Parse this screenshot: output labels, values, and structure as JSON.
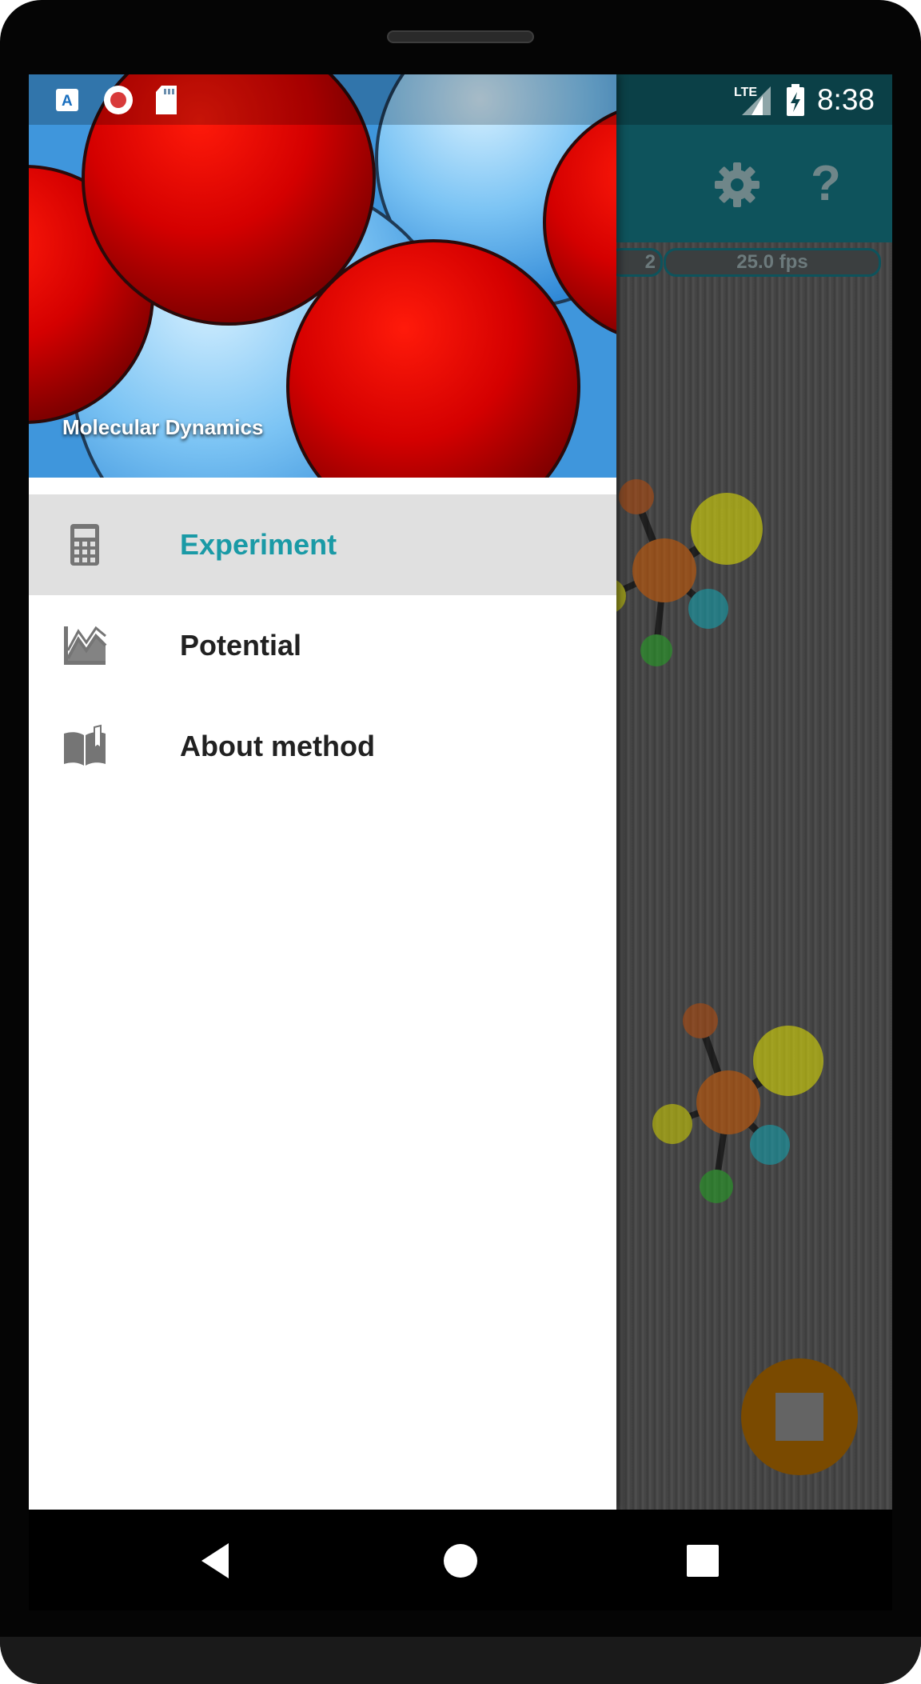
{
  "status_bar": {
    "time": "8:38",
    "network": "LTE",
    "left_icons": [
      "accessibility-app-icon",
      "recording-icon",
      "sd-card-icon"
    ]
  },
  "drawer": {
    "header_title": "Molecular Dynamics",
    "items": [
      {
        "label": "Experiment",
        "icon": "calculator-icon",
        "selected": true
      },
      {
        "label": "Potential",
        "icon": "chart-line-icon",
        "selected": false
      },
      {
        "label": "About method",
        "icon": "book-icon",
        "selected": false
      }
    ]
  },
  "background_app": {
    "toolbar_icons": [
      "settings-icon",
      "help-icon"
    ],
    "help_glyph": "?",
    "stats": [
      "2",
      "25.0 fps"
    ]
  },
  "navigation": {
    "buttons": [
      "back",
      "home",
      "recents"
    ]
  },
  "colors": {
    "accent": "#1a9aa6",
    "toolbar": "#0e535c",
    "status_dark": "#0b4047",
    "selected_row": "#e0e0e0",
    "fab": "#7a4a00"
  }
}
